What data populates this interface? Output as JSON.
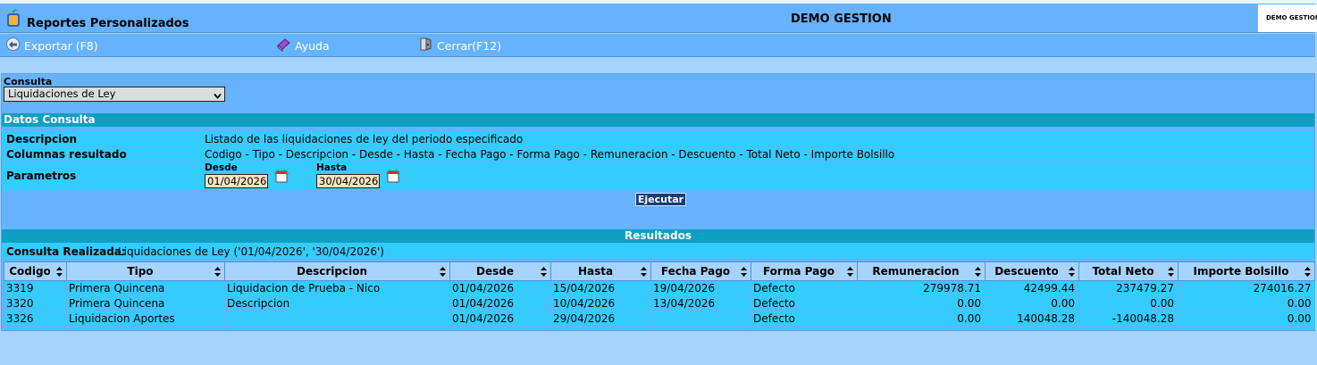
{
  "header": {
    "app_title": "Reportes Personalizados",
    "company": "DEMO GESTION",
    "logo_text": "DEMO GESTION"
  },
  "toolbar": {
    "export_label": "Exportar (F8)",
    "help_label": "Ayuda",
    "close_label": "Cerrar(F12)"
  },
  "consulta": {
    "label": "Consulta",
    "selected": "Liquidaciones de Ley"
  },
  "datos": {
    "title": "Datos Consulta",
    "descripcion_label": "Descripcion",
    "descripcion_value": "Listado de las liquidaciones de ley del periodo especificado",
    "columnas_label": "Columnas resultado",
    "columnas_value": "Codigo - Tipo - Descripcion - Desde - Hasta - Fecha Pago - Forma Pago - Remuneracion - Descuento - Total Neto - Importe Bolsillo",
    "parametros_label": "Parametros",
    "desde_label": "Desde",
    "desde_value": "01/04/2026",
    "hasta_label": "Hasta",
    "hasta_value": "30/04/2026",
    "ejecutar_label": "Ejecutar"
  },
  "resultados": {
    "title": "Resultados",
    "summary_label": "Consulta Realizada:",
    "summary_value": "Liquidaciones de Ley ('01/04/2026', '30/04/2026')",
    "columns": [
      "Codigo",
      "Tipo",
      "Descripcion",
      "Desde",
      "Hasta",
      "Fecha Pago",
      "Forma Pago",
      "Remuneracion",
      "Descuento",
      "Total Neto",
      "Importe Bolsillo"
    ],
    "rows": [
      [
        "3319",
        "Primera Quincena",
        "Liquidacion de Prueba - Nico",
        "01/04/2026",
        "15/04/2026",
        "19/04/2026",
        "Defecto",
        "279978.71",
        "42499.44",
        "237479.27",
        "274016.27"
      ],
      [
        "3320",
        "Primera Quincena",
        "Descripcion",
        "01/04/2026",
        "10/04/2026",
        "13/04/2026",
        "Defecto",
        "0.00",
        "0.00",
        "0.00",
        "0.00"
      ],
      [
        "3326",
        "Liquidacion Aportes",
        "",
        "01/04/2026",
        "29/04/2026",
        "",
        "Defecto",
        "0.00",
        "140048.28",
        "-140048.28",
        "0.00"
      ]
    ]
  },
  "colors": {
    "header_bg": "#66b2fd",
    "section_bar": "#0f9fc2",
    "row_bg": "#33ccfd",
    "page_bg": "#a6d3fb",
    "button_bg": "#1a3d78"
  },
  "icons": {
    "app": "app-logo-icon",
    "export": "export-icon",
    "help": "help-book-icon",
    "close": "close-icon",
    "calendar": "calendar-icon",
    "sort": "sort-arrows-icon",
    "dropdown": "chevron-down-icon"
  }
}
